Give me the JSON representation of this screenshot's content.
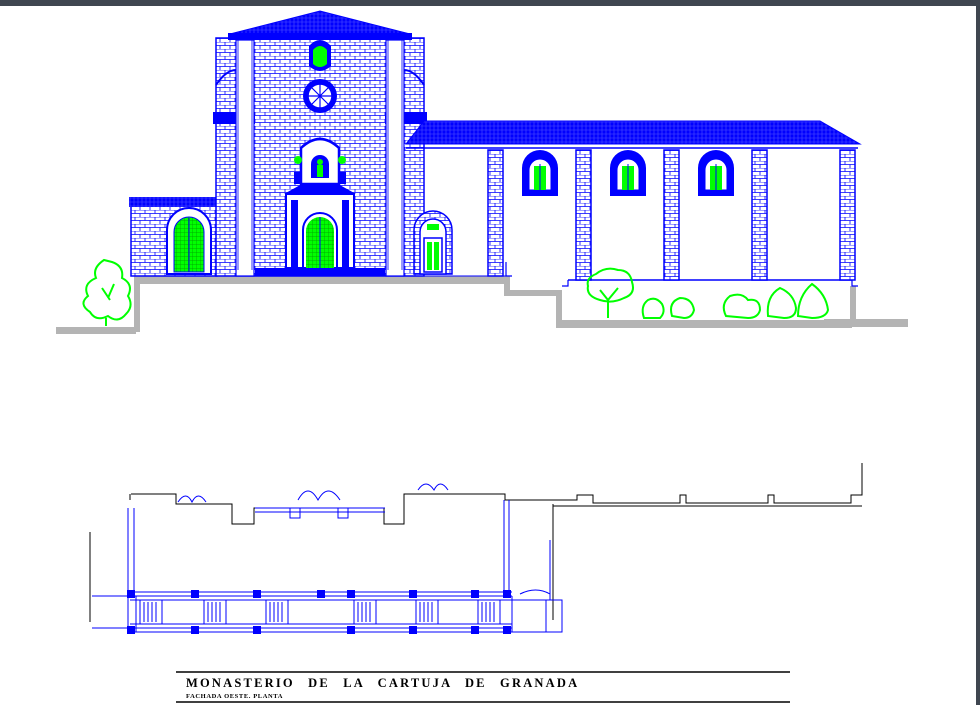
{
  "title_block": {
    "title": "MONASTERIO DE LA CARTUJA DE GRANADA",
    "subtitle": "FACHADA OESTE. PLANTA"
  },
  "colors": {
    "line_blue": "#0000ff",
    "tree_green": "#00ff00",
    "ground_gray": "#b4b4b4",
    "frame": "#3f4650"
  },
  "icons": [
    "medallion-icon",
    "rose-window-icon",
    "statue-niche-icon",
    "tree-icon",
    "shrub-icon"
  ]
}
